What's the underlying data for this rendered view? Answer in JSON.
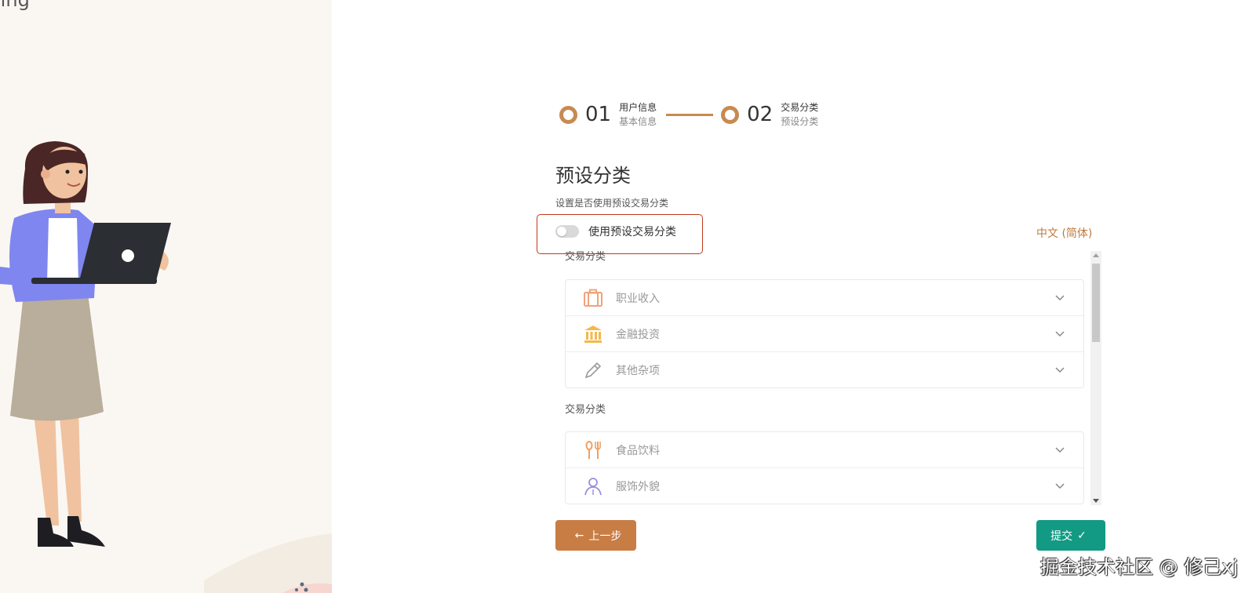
{
  "left_panel": {
    "brand_text": "oing"
  },
  "stepper": {
    "steps": [
      {
        "num": "01",
        "title": "用户信息",
        "sub": "基本信息"
      },
      {
        "num": "02",
        "title": "交易分类",
        "sub": "预设分类"
      }
    ]
  },
  "page": {
    "title": "预设分类",
    "desc": "设置是否使用预设交易分类"
  },
  "toggle": {
    "label": "使用预设交易分类",
    "checked": false
  },
  "language": "中文 (简体)",
  "groups": [
    {
      "label": "交易分类",
      "items": [
        {
          "label": "职业收入",
          "icon": "briefcase-icon",
          "color": "#f0a37a"
        },
        {
          "label": "金融投资",
          "icon": "bank-icon",
          "color": "#f5b84a"
        },
        {
          "label": "其他杂项",
          "icon": "pencil-icon",
          "color": "#9a9a9a"
        }
      ]
    },
    {
      "label": "交易分类",
      "items": [
        {
          "label": "食品饮料",
          "icon": "fork-knife-icon",
          "color": "#f0a060"
        },
        {
          "label": "服饰外貌",
          "icon": "person-icon",
          "color": "#9b8fe0"
        }
      ]
    }
  ],
  "buttons": {
    "prev": "上一步",
    "submit": "提交"
  },
  "colors": {
    "accent": "#c78a51",
    "prev_button": "#c87d45",
    "submit_button": "#129a84",
    "highlight": "#c0391b"
  },
  "watermark": "掘金技术社区 @ 修己xj"
}
